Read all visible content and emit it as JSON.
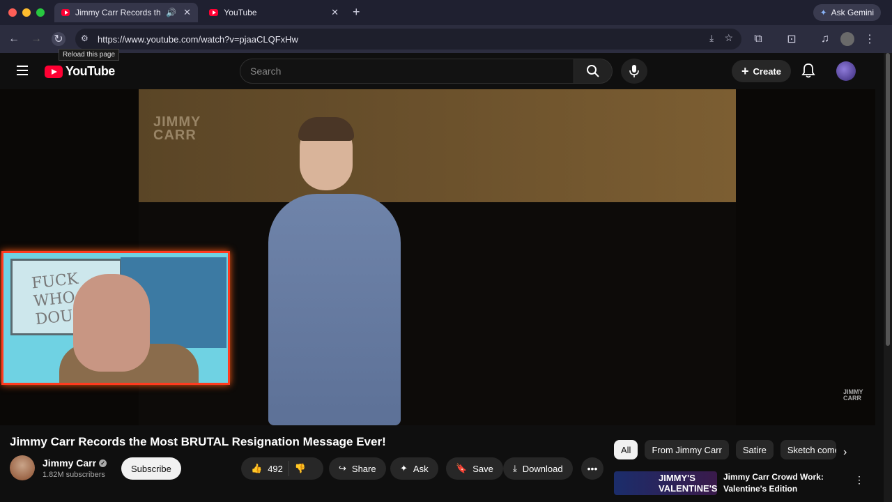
{
  "browser": {
    "tabs": [
      {
        "title": "Jimmy Carr Records the M",
        "active": true
      },
      {
        "title": "YouTube",
        "active": false
      }
    ],
    "new_tab": "+",
    "gemini": "Ask Gemini",
    "url": "https://www.youtube.com/watch?v=pjaaCLQFxHw",
    "tooltip": "Reload this page"
  },
  "youtube": {
    "logo": "YouTube",
    "search_placeholder": "Search",
    "create": "Create"
  },
  "video": {
    "overlay_logo_line1": "JIMMY",
    "overlay_logo_line2": "CARR",
    "watermark_line1": "JIMMY",
    "watermark_line2": "CARR",
    "whiteboard_text_line1": "FUCK",
    "whiteboard_text_line2": "WHO",
    "whiteboard_text_line3": "DOUBT"
  },
  "details": {
    "title": "Jimmy Carr Records the Most BRUTAL Resignation Message Ever!",
    "channel": "Jimmy Carr",
    "subscribers": "1.82M subscribers",
    "subscribe": "Subscribe",
    "likes": "492",
    "share": "Share",
    "ask": "Ask",
    "save": "Save",
    "download": "Download"
  },
  "chips": [
    "All",
    "From Jimmy Carr",
    "Satire",
    "Sketch come"
  ],
  "recommendation": {
    "thumb_text_line1": "JIMMY'S",
    "thumb_text_line2": "VALENTINE'S",
    "title_line1": "Jimmy Carr Crowd Work:",
    "title_line2": "Valentine's Edition"
  },
  "colors": {
    "accent": "#ff0033",
    "pip_border": "#ff3b1f"
  }
}
